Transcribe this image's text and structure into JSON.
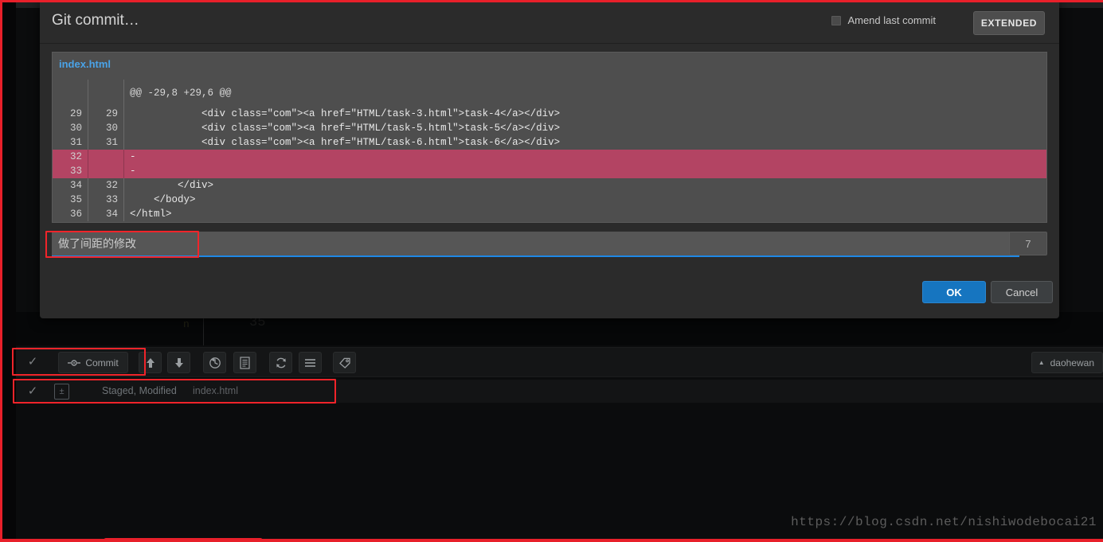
{
  "dialog": {
    "title": "Git commit…",
    "amend_label": "Amend last commit",
    "amend_checked": false,
    "extended_label": "EXTENDED",
    "ok_label": "OK",
    "cancel_label": "Cancel"
  },
  "diff": {
    "filename": "index.html",
    "hunk_header": "@@ -29,8 +29,6 @@",
    "rows": [
      {
        "type": "hunk",
        "old": "",
        "new": "",
        "text": "@@ -29,8 +29,6 @@"
      },
      {
        "type": "ctx",
        "old": "29",
        "new": "29",
        "text": "            <div class=\"com\"><a href=\"HTML/task-3.html\">task-4</a></div>"
      },
      {
        "type": "ctx",
        "old": "30",
        "new": "30",
        "text": "            <div class=\"com\"><a href=\"HTML/task-5.html\">task-5</a></div>"
      },
      {
        "type": "ctx",
        "old": "31",
        "new": "31",
        "text": "            <div class=\"com\"><a href=\"HTML/task-6.html\">task-6</a></div>"
      },
      {
        "type": "del",
        "old": "32",
        "new": "",
        "text": "-"
      },
      {
        "type": "del",
        "old": "33",
        "new": "",
        "text": "-"
      },
      {
        "type": "ctx",
        "old": "34",
        "new": "32",
        "text": "        </div>"
      },
      {
        "type": "ctx",
        "old": "35",
        "new": "33",
        "text": "    </body>"
      },
      {
        "type": "ctx",
        "old": "36",
        "new": "34",
        "text": "</html>"
      }
    ]
  },
  "message": {
    "value": "做了间距的修改",
    "placeholder": "",
    "counter": "7"
  },
  "toolbar": {
    "check_glyph": "✓",
    "commit_label": "Commit",
    "commit_icon": "commit-node-icon",
    "push_icon": "arrow-up-icon",
    "pull_icon": "arrow-down-icon",
    "history_icon": "revert-clock-icon",
    "doc_icon": "document-icon",
    "refresh_icon": "refresh-icon",
    "menu_icon": "hamburger-menu-icon",
    "tag_icon": "tag-icon",
    "branch_label": "daohewan",
    "branch_chevron": "▲"
  },
  "file_row": {
    "check_glyph": "✓",
    "file_icon": "modified-file-icon",
    "status": "Staged, Modified",
    "name": "index.html"
  },
  "background": {
    "code_fragment_1": "n",
    "code_fragment_2": "35"
  },
  "watermark": "https://blog.csdn.net/nishiwodebocai21",
  "colors": {
    "accent_blue": "#1e88e5",
    "ok_button": "#1675c0",
    "delete_row": "#b34463",
    "filename_blue": "#4aa3e8",
    "annotation_red": "#f0242a",
    "dialog_bg": "#2b2b2b",
    "diff_bg": "#4e4e4e"
  }
}
